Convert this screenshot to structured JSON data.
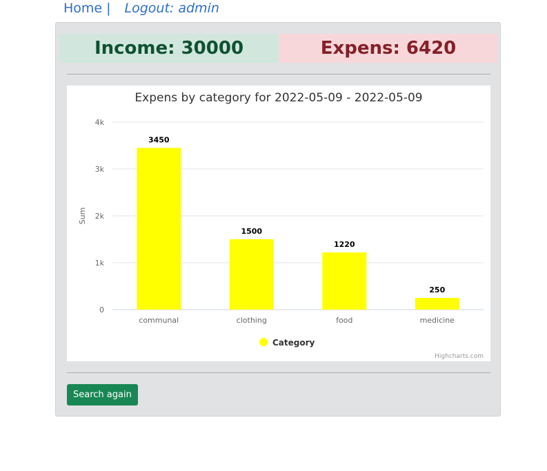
{
  "nav": {
    "home_label": "Home",
    "separator": "|",
    "logout_label": "Logout: admin"
  },
  "summary": {
    "income_text": "Income: 30000",
    "expens_text": "Expens: 6420"
  },
  "chart_data": {
    "type": "bar",
    "title": "Expens by category for 2022-05-09 - 2022-05-09",
    "xlabel": "",
    "ylabel": "Sum",
    "categories": [
      "communal",
      "clothing",
      "food",
      "medicine"
    ],
    "series": [
      {
        "name": "Category",
        "values": [
          3450,
          1500,
          1220,
          250
        ],
        "color": "#ffff00"
      }
    ],
    "ylim": [
      0,
      4000
    ],
    "yticks": [
      0,
      1000,
      2000,
      3000,
      4000
    ],
    "ytick_labels": [
      "0",
      "1k",
      "2k",
      "3k",
      "4k"
    ],
    "grid": true,
    "legend": "bottom-center",
    "data_labels": true,
    "credits": "Highcharts.com"
  },
  "actions": {
    "search_again_label": "Search again"
  },
  "colors": {
    "accent": "#198754",
    "income_bg": "#d1e7dd",
    "expens_bg": "#f8d7da",
    "bar": "#ffff00"
  }
}
